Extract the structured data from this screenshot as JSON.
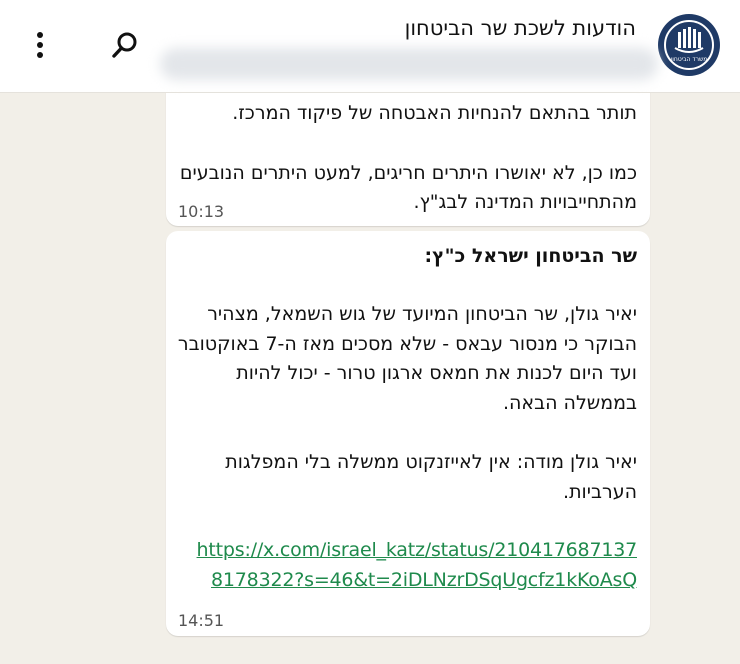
{
  "header": {
    "title": "הודעות לשכת שר הביטחון",
    "avatar_label": "משרד הביטחון",
    "subtitle": ""
  },
  "messages": [
    {
      "lines": [
        "תותר בהתאם להנחיות האבטחה של פיקוד המרכז.",
        "כמו כן, לא יאושרו היתרים חריגים, למעט היתרים הנובעים",
        "מהתחייבויות המדינה לבג\"ץ."
      ],
      "time": "10:13"
    },
    {
      "heading": "שר הביטחון ישראל כ\"ץ:",
      "lines": [
        "יאיר גולן, שר הביטחון המיועד של גוש השמאל, מצהיר",
        "הבוקר כי מנסור עבאס - שלא מסכים מאז ה-7 באוקטובר",
        "ועד היום לכנות את חמאס ארגון טרור - יכול להיות",
        "בממשלה הבאה.",
        "יאיר גולן מודה: אין לאייזנקוט ממשלה בלי המפלגות",
        "הערביות."
      ],
      "link_lines": [
        "https://x.com/israel_katz/status/210417687137",
        "8178322?s=46&t=2iDLNzrDSqUgcfz1kKoAsQ"
      ],
      "time": "14:51"
    }
  ],
  "colors": {
    "header_bg": "#ffffff",
    "chat_bg": "#f2efe8",
    "bubble_bg": "#ffffff",
    "link": "#1f8a4c",
    "avatar": "#1f3a66"
  },
  "icons": [
    "avatar-logo-icon",
    "search-icon",
    "more-vert-icon"
  ]
}
